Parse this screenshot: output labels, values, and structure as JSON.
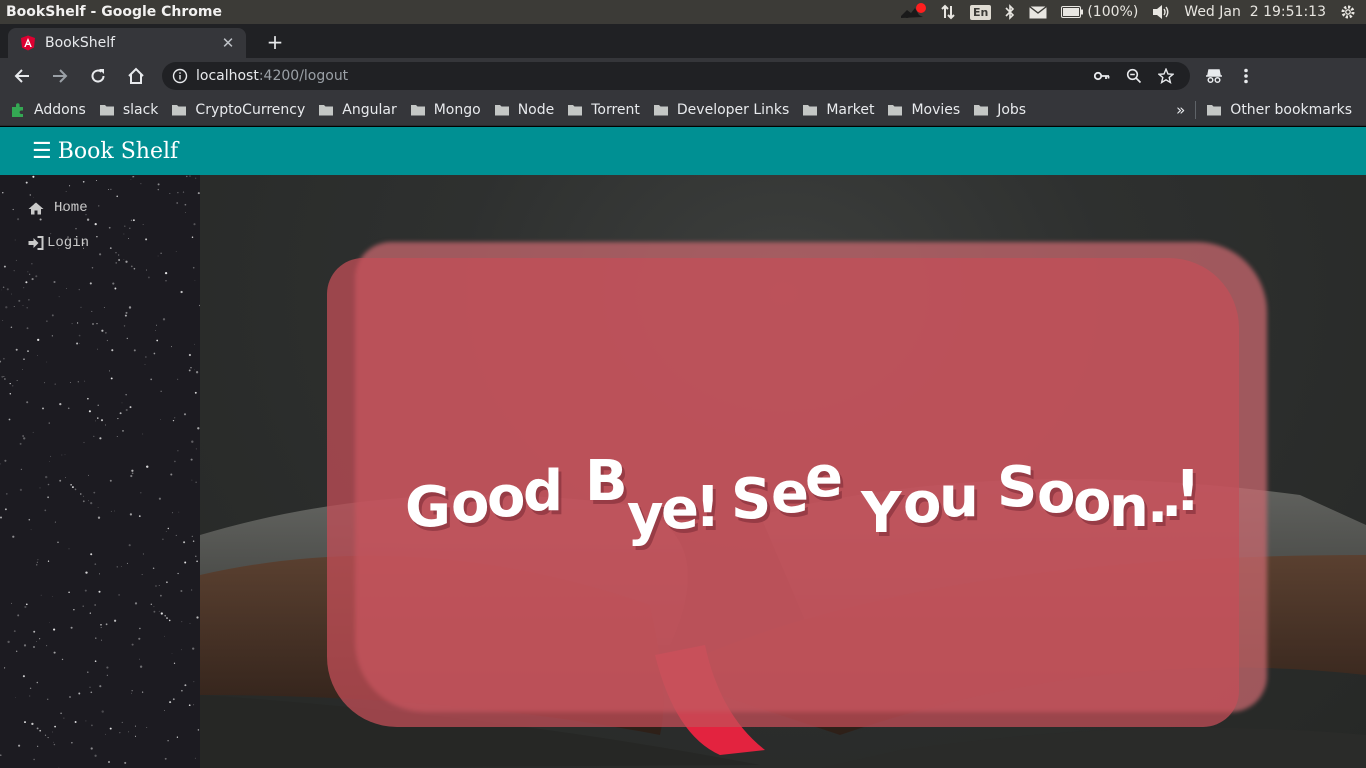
{
  "os_panel": {
    "window_title": "BookShelf - Google Chrome",
    "language": "En",
    "battery": "(100%)",
    "clock": "Wed Jan  2 19:51:13"
  },
  "browser": {
    "tab": {
      "title": "BookShelf",
      "favicon": "angular-icon"
    },
    "address_bar": {
      "host": "localhost",
      "path": ":4200/logout"
    },
    "bookmarks": [
      {
        "label": "Addons",
        "icon": "puzzle-icon"
      },
      {
        "label": "slack",
        "icon": "folder-icon"
      },
      {
        "label": "CryptoCurrency",
        "icon": "folder-icon"
      },
      {
        "label": "Angular",
        "icon": "folder-icon"
      },
      {
        "label": "Mongo",
        "icon": "folder-icon"
      },
      {
        "label": "Node",
        "icon": "folder-icon"
      },
      {
        "label": "Torrent",
        "icon": "folder-icon"
      },
      {
        "label": "Developer Links",
        "icon": "folder-icon"
      },
      {
        "label": "Market",
        "icon": "folder-icon"
      },
      {
        "label": "Movies",
        "icon": "folder-icon"
      },
      {
        "label": "Jobs",
        "icon": "folder-icon"
      }
    ],
    "bookmarks_overflow": "»",
    "other_bookmarks": "Other bookmarks"
  },
  "app": {
    "menu_icon": "☰",
    "title": "Book Shelf",
    "header_color": "#009093",
    "sidebar": [
      {
        "label": "Home",
        "icon": "home-icon"
      },
      {
        "label": "Login",
        "icon": "sign-in-icon"
      }
    ],
    "message": "Good Bye! See You Soon..!",
    "card_color": "#c44e58"
  }
}
